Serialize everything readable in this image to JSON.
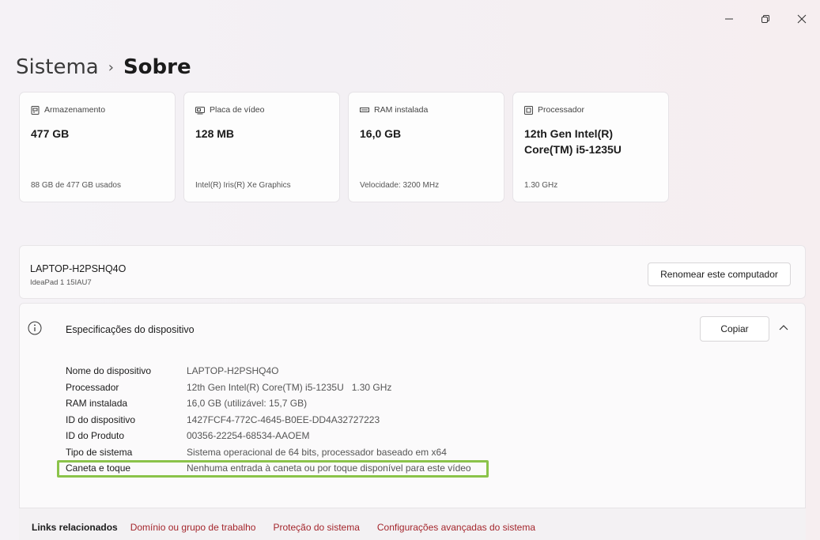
{
  "window": {
    "minimize_glyph": "—",
    "restore_glyph": "▢",
    "close_glyph": "✕"
  },
  "header": {
    "crumb": "Sistema",
    "separator": "›",
    "current": "Sobre"
  },
  "cards": [
    {
      "icon": "storage-icon",
      "label": "Armazenamento",
      "value": "477 GB",
      "foot": "88 GB de 477 GB usados"
    },
    {
      "icon": "display-adapter-icon",
      "label": "Placa de vídeo",
      "value": "128 MB",
      "foot": "Intel(R) Iris(R) Xe Graphics"
    },
    {
      "icon": "ram-icon",
      "label": "RAM instalada",
      "value": "16,0 GB",
      "foot": "Velocidade: 3200 MHz"
    },
    {
      "icon": "processor-icon",
      "label": "Processador",
      "value": "12th Gen Intel(R) Core(TM) i5-1235U",
      "foot": "1.30 GHz"
    }
  ],
  "device": {
    "name": "LAPTOP-H2PSHQ4O",
    "model": "IdeaPad 1 15IAU7",
    "rename_label": "Renomear este computador"
  },
  "specs": {
    "title": "Especificações do dispositivo",
    "copy_label": "Copiar",
    "rows": [
      {
        "label": "Nome do dispositivo",
        "value": "LAPTOP-H2PSHQ4O"
      },
      {
        "label": "Processador",
        "value": "12th Gen Intel(R) Core(TM) i5-1235U   1.30 GHz"
      },
      {
        "label": "RAM instalada",
        "value": "16,0 GB (utilizável: 15,7 GB)"
      },
      {
        "label": "ID do dispositivo",
        "value": "1427FCF4-772C-4645-B0EE-DD4A32727223"
      },
      {
        "label": "ID do Produto",
        "value": "00356-22254-68534-AAOEM"
      },
      {
        "label": "Tipo de sistema",
        "value": "Sistema operacional de 64 bits, processador baseado em x64"
      },
      {
        "label": "Caneta e toque",
        "value": "Nenhuma entrada à caneta ou por toque disponível para este vídeo"
      }
    ]
  },
  "related_links": {
    "label": "Links relacionados",
    "links": [
      "Domínio ou grupo de trabalho",
      "Proteção do sistema",
      "Configurações avançadas do sistema"
    ]
  },
  "colors": {
    "link": "#a4262c",
    "highlight": "#8bc34a"
  }
}
